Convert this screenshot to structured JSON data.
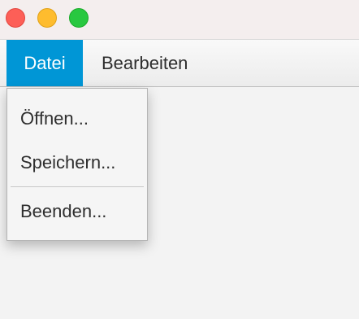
{
  "window": {
    "controls": [
      {
        "name": "close",
        "icon": "close-traffic-light-icon",
        "color": "#fd5f57"
      },
      {
        "name": "minimize",
        "icon": "minimize-traffic-light-icon",
        "color": "#febc2e"
      },
      {
        "name": "maximize",
        "icon": "maximize-traffic-light-icon",
        "color": "#28c840"
      }
    ]
  },
  "menubar": {
    "items": [
      {
        "label": "Datei",
        "active": true,
        "active_color": "#0096d6"
      },
      {
        "label": "Bearbeiten",
        "active": false
      }
    ]
  },
  "dropdown": {
    "items": [
      {
        "label": "Öffnen..."
      },
      {
        "label": "Speichern..."
      },
      {
        "label": "Beenden..."
      }
    ]
  }
}
